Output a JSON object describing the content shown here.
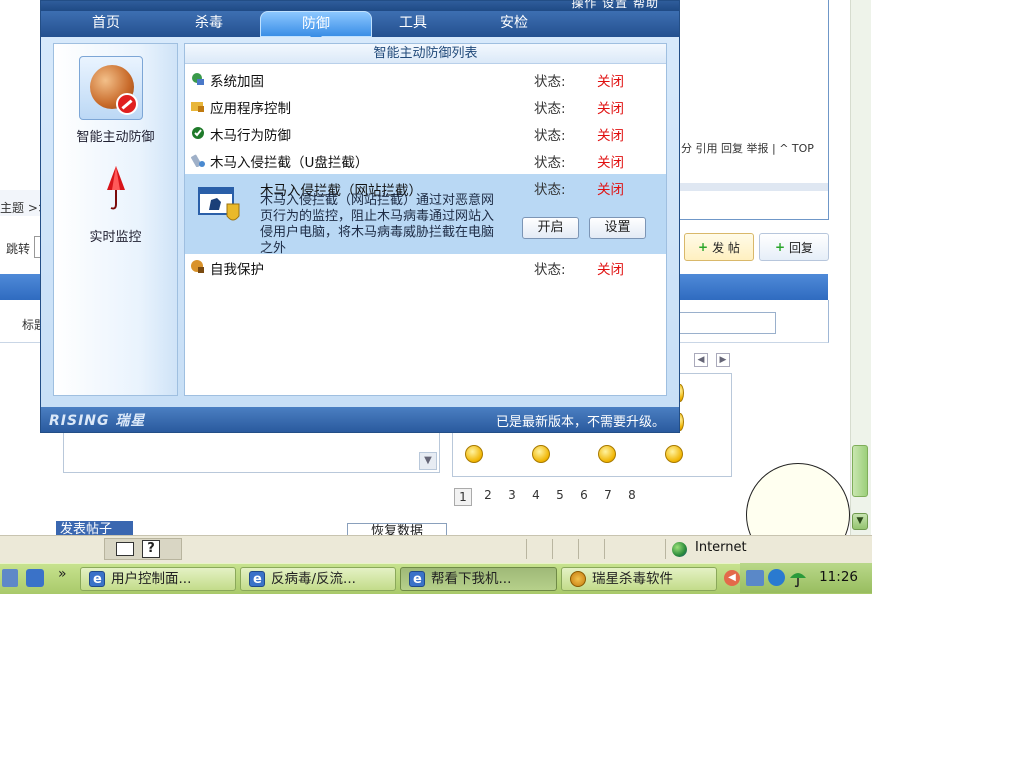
{
  "window": {
    "title_partial": "操作   设置   帮助",
    "tabs": [
      {
        "label": "首页"
      },
      {
        "label": "杀毒"
      },
      {
        "label": "防御"
      },
      {
        "label": "工具"
      },
      {
        "label": "安检"
      }
    ],
    "left_panel": [
      {
        "label": "智能主动防御"
      },
      {
        "label": "实时监控"
      }
    ],
    "list_header": "智能主动防御列表",
    "status_label": "状态:",
    "items": [
      {
        "name": "系统加固",
        "status": "关闭"
      },
      {
        "name": "应用程序控制",
        "status": "关闭"
      },
      {
        "name": "木马行为防御",
        "status": "关闭"
      },
      {
        "name": "木马入侵拦截（U盘拦截）",
        "status": "关闭"
      },
      {
        "name": "木马入侵拦截（网站拦截）",
        "status": "关闭",
        "description": "木马入侵拦截（网站拦截）通过对恶意网页行为的监控，阻止木马病毒通过网站入侵用户电脑，将木马病毒威胁拦截在电脑之外",
        "buttons": {
          "enable": "开启",
          "settings": "设置"
        }
      },
      {
        "name": "自我保护",
        "status": "关闭"
      }
    ],
    "status_bar": {
      "logo": "RISING 瑞星",
      "message": "已是最新版本，不需要升级。"
    }
  },
  "background": {
    "breadcrumb_fragment": "主题 >>",
    "jump_label": "跳转",
    "footer_links": "分 引用 回复 举报 | ^ TOP",
    "post_button": "发 帖",
    "reply_button": "回复",
    "title_label": "标题",
    "pages": [
      "1",
      "2",
      "3",
      "4",
      "5",
      "6",
      "7",
      "8"
    ],
    "bottom_left": "发表帖子",
    "bottom_mid": "恢复数据"
  },
  "ie_status": {
    "zone": "Internet"
  },
  "taskbar": {
    "chevron": "»",
    "buttons": [
      {
        "label": "用户控制面..."
      },
      {
        "label": "反病毒/反流..."
      },
      {
        "label": "帮看下我机..."
      },
      {
        "label": "瑞星杀毒软件"
      }
    ],
    "clock": "11:26"
  }
}
